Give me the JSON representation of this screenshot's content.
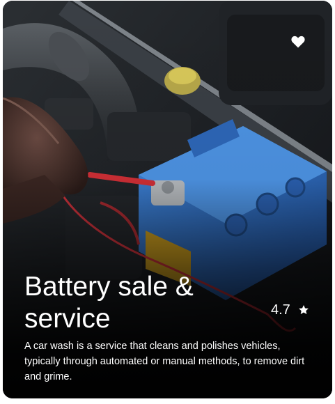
{
  "card": {
    "title": "Battery sale & service",
    "rating": "4.7",
    "description": "A car wash is a service that cleans and polishes vehicles, typically through automated or manual methods, to remove dirt and grime.",
    "image_subject": "car battery under hood",
    "icons": {
      "favorite": "heart-icon",
      "rating": "star-icon"
    },
    "colors": {
      "text": "#ffffff",
      "battery": "#2f6fc4",
      "wire": "#d8343a"
    }
  }
}
